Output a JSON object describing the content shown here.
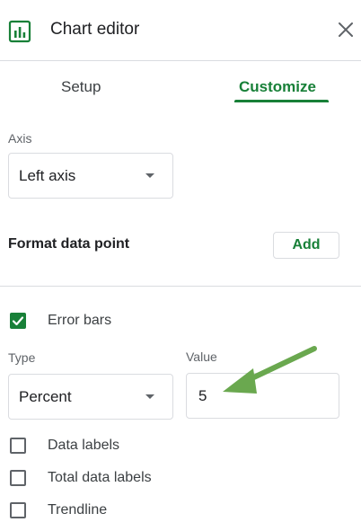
{
  "header": {
    "title": "Chart editor",
    "icon": "chart-icon",
    "close_icon": "close-icon"
  },
  "tabs": [
    {
      "label": "Setup",
      "active": false
    },
    {
      "label": "Customize",
      "active": true
    }
  ],
  "axis": {
    "label": "Axis",
    "selected": "Left axis"
  },
  "format_data_point": {
    "title": "Format data point",
    "add_label": "Add"
  },
  "error_bars": {
    "label": "Error bars",
    "checked": true,
    "type_label": "Type",
    "type_selected": "Percent",
    "value_label": "Value",
    "value": "5"
  },
  "options": [
    {
      "label": "Data labels",
      "checked": false
    },
    {
      "label": "Total data labels",
      "checked": false
    },
    {
      "label": "Trendline",
      "checked": false
    }
  ],
  "colors": {
    "accent": "#188038",
    "annotation_arrow": "#6aa84f",
    "border": "#dadce0"
  }
}
